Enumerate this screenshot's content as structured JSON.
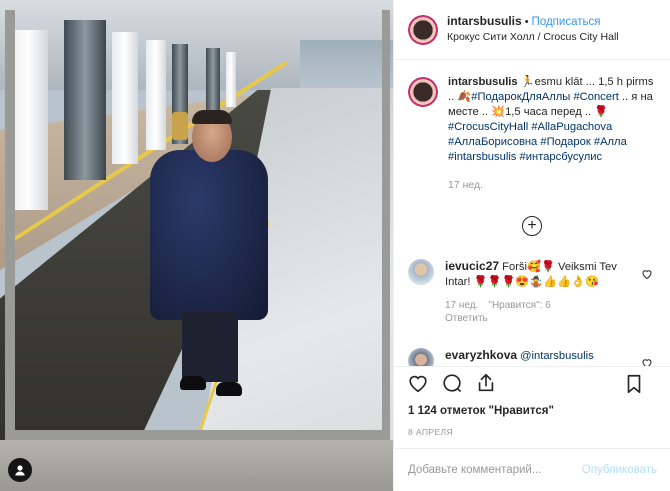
{
  "post": {
    "username": "intarsbusulis",
    "dot": "•",
    "follow_label": "Подписаться",
    "location": "Крокус Сити Холл / Crocus City Hall",
    "caption": {
      "username": "intarsbusulis",
      "segments": [
        {
          "t": " 🏃esmu klāt ... 1,5 h pirms .. 🍂",
          "k": "text"
        },
        {
          "t": "#ПодарокДляАллы",
          "k": "tag"
        },
        {
          "t": " ",
          "k": "text"
        },
        {
          "t": "#Concert",
          "k": "tag"
        },
        {
          "t": " .. я на месте .. 💥1,5 часа перед .. 🌹",
          "k": "text"
        },
        {
          "t": "#CrocusCityHall",
          "k": "tag"
        },
        {
          "t": " ",
          "k": "text"
        },
        {
          "t": "#AllaPugachova",
          "k": "tag"
        },
        {
          "t": " ",
          "k": "text"
        },
        {
          "t": "#АллаБорисовна",
          "k": "tag"
        },
        {
          "t": " ",
          "k": "text"
        },
        {
          "t": "#Подарок",
          "k": "tag"
        },
        {
          "t": " ",
          "k": "text"
        },
        {
          "t": "#Алла",
          "k": "tag"
        },
        {
          "t": " ",
          "k": "text"
        },
        {
          "t": "#intarsbusulis",
          "k": "tag"
        },
        {
          "t": " ",
          "k": "text"
        },
        {
          "t": "#интарсбусулис",
          "k": "tag"
        }
      ],
      "ago": "17 нед."
    },
    "load_more_label": "+",
    "comments": [
      {
        "username": "ievucic27",
        "text": " Forši🥰🌹 Veiksmi Tev Intar! 🌹🌹🌹😍🤹👍👍👌😘",
        "ago": "17 нед.",
        "likes": "\"Нравится\": 6",
        "reply": "Ответить"
      },
      {
        "username": "evaryzhkova",
        "text": " @intarsbusulis",
        "ago": "",
        "likes": "",
        "reply": ""
      }
    ],
    "likes_count": "1 124 отметок \"Нравится\"",
    "date": "8 АПРЕЛЯ",
    "comment_placeholder": "Добавьте комментарий...",
    "publish_label": "Опубликовать"
  },
  "colors": {
    "link": "#3897f0",
    "tag": "#003569",
    "muted": "#999999",
    "publish_disabled": "#b2dffc"
  },
  "icons": {
    "photo_badge": "user-icon",
    "like": "heart-icon",
    "comment": "comment-icon",
    "share": "share-icon",
    "save": "bookmark-icon"
  }
}
